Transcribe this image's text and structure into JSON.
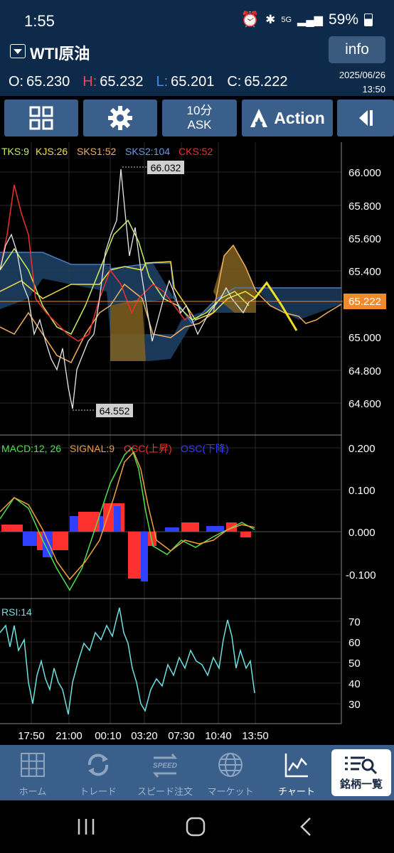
{
  "status": {
    "time": "1:55",
    "battery": "59%",
    "net": "5G"
  },
  "header": {
    "symbol": "WTI原油",
    "info_label": "info",
    "date": "2025/06/26",
    "clock": "13:50"
  },
  "ohlc": [
    {
      "label": "O:",
      "value": "65.230"
    },
    {
      "label": "H:",
      "value": "65.232"
    },
    {
      "label": "L:",
      "value": "65.201"
    },
    {
      "label": "C:",
      "value": "65.222"
    }
  ],
  "toolbar": {
    "interval": "10分",
    "side": "ASK",
    "action_label": "Action"
  },
  "colors": {
    "bg": "#000000",
    "header": "#0d2a4a",
    "button": "#3a5f8a",
    "price_badge": "#f08a2a",
    "rsi": "#6fe0e0"
  },
  "main_legend": [
    {
      "text": "TKS:9",
      "color": "#c8f060"
    },
    {
      "text": "KJS:26",
      "color": "#f0e040"
    },
    {
      "text": "SKS1:52",
      "color": "#f0b060"
    },
    {
      "text": "SKS2:104",
      "color": "#6a9ae0"
    },
    {
      "text": "CKS:52",
      "color": "#f03030"
    }
  ],
  "annotations": {
    "high": "66.032",
    "low": "64.552",
    "current": "65.222"
  },
  "price_axis": [
    "66.000",
    "65.800",
    "65.600",
    "65.400",
    "65.200",
    "65.000",
    "64.800",
    "64.600"
  ],
  "macd_legend": [
    {
      "text": "MACD:12, 26",
      "color": "#50e050"
    },
    {
      "text": "SIGNAL:9",
      "color": "#f0a040"
    },
    {
      "text": "OSC(上昇)",
      "color": "#ff3030"
    },
    {
      "text": "OSC(下降)",
      "color": "#3040ff"
    }
  ],
  "macd_axis": [
    "0.200",
    "0.100",
    "0.000",
    "-0.100"
  ],
  "rsi_legend": "RSI:14",
  "rsi_axis": [
    "70",
    "60",
    "50",
    "40",
    "30"
  ],
  "time_axis": [
    "17:50",
    "21:00",
    "00:10",
    "03:20",
    "07:30",
    "10:40",
    "13:50"
  ],
  "nav": [
    {
      "label": "ホーム",
      "icon": "grid-icon"
    },
    {
      "label": "トレード",
      "icon": "refresh-icon"
    },
    {
      "label": "スピード注文",
      "icon": "speed-icon"
    },
    {
      "label": "マーケット",
      "icon": "globe-icon"
    },
    {
      "label": "チャート",
      "icon": "chart-icon"
    }
  ],
  "list_label": "銘柄一覧",
  "chart_data": [
    {
      "type": "line",
      "title": "",
      "x": [
        "17:50",
        "21:00",
        "00:10",
        "03:20",
        "07:30",
        "10:40",
        "13:50"
      ],
      "series": [
        {
          "name": "",
          "values": [
            65.45,
            64.95,
            65.6,
            65.05,
            65.1,
            65.3,
            65.222
          ]
        }
      ],
      "ylim": [
        64.55,
        66.06
      ]
    },
    {
      "type": "line",
      "x": [
        "17:50",
        "21:00",
        "00:10",
        "03:20",
        "07:30",
        "10:40",
        "13:50"
      ],
      "series": [
        {
          "name": "MACD",
          "values": [
            0.06,
            -0.12,
            0.06,
            0.17,
            -0.02,
            0.02,
            0.0
          ]
        },
        {
          "name": "SIGNAL",
          "values": [
            0.04,
            -0.08,
            0.02,
            0.19,
            0.0,
            0.01,
            0.0
          ]
        }
      ],
      "ylim": [
        -0.13,
        0.21
      ]
    },
    {
      "type": "line",
      "x": [
        "17:50",
        "21:00",
        "00:10",
        "03:20",
        "07:30",
        "10:40",
        "13:50"
      ],
      "series": [
        {
          "name": "RSI",
          "values": [
            65,
            28,
            75,
            30,
            52,
            70,
            33
          ]
        }
      ],
      "ylim": [
        22,
        76
      ]
    }
  ]
}
